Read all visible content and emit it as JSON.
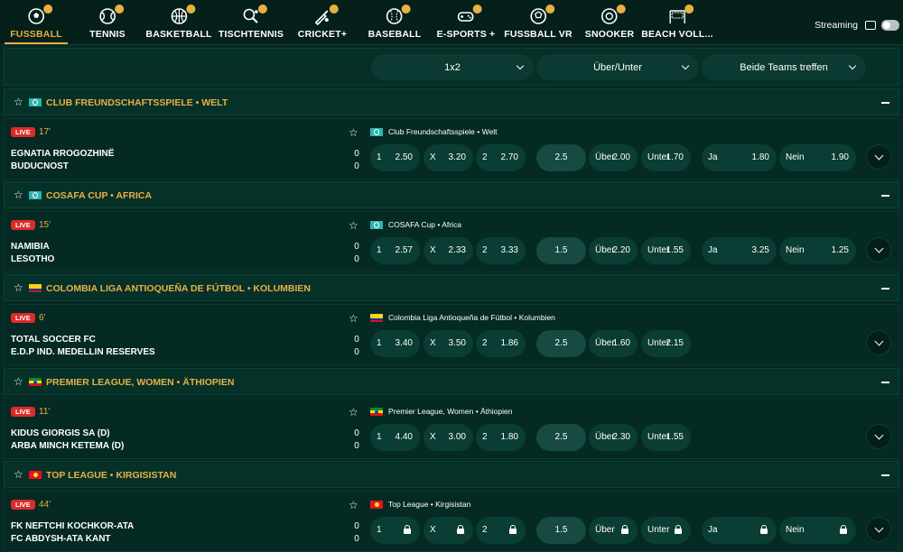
{
  "sports_tabs": [
    {
      "label": "FUSSBALL",
      "icon": "soccer-ball-icon",
      "active": true
    },
    {
      "label": "TENNIS",
      "icon": "tennis-ball-icon"
    },
    {
      "label": "BASKETBALL",
      "icon": "basketball-icon"
    },
    {
      "label": "TISCHTENNIS",
      "icon": "table-tennis-icon"
    },
    {
      "label": "CRICKET+",
      "icon": "cricket-icon"
    },
    {
      "label": "BASEBALL",
      "icon": "baseball-icon"
    },
    {
      "label": "E-SPORTS +",
      "icon": "gamepad-icon"
    },
    {
      "label": "FUSSBALL VR",
      "icon": "soccer-ball-vr-icon"
    },
    {
      "label": "SNOOKER",
      "icon": "snooker-icon"
    },
    {
      "label": "BEACH VOLL...",
      "icon": "beach-volleyball-icon"
    }
  ],
  "streaming": {
    "label": "Streaming",
    "enabled": false
  },
  "filters": {
    "market": "1x2",
    "overunder": "Über/Unter",
    "btts": "Beide Teams treffen"
  },
  "colors": {
    "accent": "#e8b043",
    "live": "#dc2b2b",
    "background": "#052a23"
  },
  "leagues": [
    {
      "title": "CLUB FREUNDSCHAFTSSPIELE • WELT",
      "flag": "world",
      "match": {
        "live": "LIVE",
        "minute": "17'",
        "league": "Club Freundschaftsspiele • Welt",
        "team1": "EGNATIA RROGOZHINË",
        "team2": "BUDUCNOST",
        "score1": "0",
        "score2": "0",
        "odds": {
          "k1": "1",
          "o1": "2.50",
          "kx": "X",
          "ox": "3.20",
          "k2": "2",
          "o2": "2.70",
          "line": "2.5",
          "kover": "Über",
          "oover": "2.00",
          "kunder": "Unter",
          "ounder": "1.70",
          "kyes": "Ja",
          "oyes": "1.80",
          "kno": "Nein",
          "ono": "1.90"
        }
      }
    },
    {
      "title": "COSAFA CUP • AFRICA",
      "flag": "world",
      "match": {
        "live": "LIVE",
        "minute": "15'",
        "league": "COSAFA Cup • Africa",
        "team1": "NAMIBIA",
        "team2": "LESOTHO",
        "score1": "0",
        "score2": "0",
        "odds": {
          "k1": "1",
          "o1": "2.57",
          "kx": "X",
          "ox": "2.33",
          "k2": "2",
          "o2": "3.33",
          "line": "1.5",
          "kover": "Über",
          "oover": "2.20",
          "kunder": "Unter",
          "ounder": "1.55",
          "kyes": "Ja",
          "oyes": "3.25",
          "kno": "Nein",
          "ono": "1.25"
        }
      }
    },
    {
      "title": "COLOMBIA LIGA ANTIOQUEÑA DE FÚTBOL • KOLUMBIEN",
      "flag": "colombia",
      "match": {
        "live": "LIVE",
        "minute": "6'",
        "league": "Colombia Liga Antioqueña de Fútbol • Kolumbien",
        "team1": "TOTAL SOCCER FC",
        "team2": "E.D.P IND. MEDELLIN RESERVES",
        "score1": "0",
        "score2": "0",
        "odds": {
          "k1": "1",
          "o1": "3.40",
          "kx": "X",
          "ox": "3.50",
          "k2": "2",
          "o2": "1.86",
          "line": "2.5",
          "kover": "Über",
          "oover": "1.60",
          "kunder": "Unter",
          "ounder": "2.15"
        }
      }
    },
    {
      "title": "PREMIER LEAGUE, WOMEN • ÄTHIOPIEN",
      "flag": "ethiopia",
      "match": {
        "live": "LIVE",
        "minute": "11'",
        "league": "Premier League, Women • Äthiopien",
        "team1": "KIDUS GIORGIS SA (D)",
        "team2": "ARBA MINCH KETEMA (D)",
        "score1": "0",
        "score2": "0",
        "odds": {
          "k1": "1",
          "o1": "4.40",
          "kx": "X",
          "ox": "3.00",
          "k2": "2",
          "o2": "1.80",
          "line": "2.5",
          "kover": "Über",
          "oover": "2.30",
          "kunder": "Unter",
          "ounder": "1.55"
        }
      }
    },
    {
      "title": "TOP LEAGUE • KIRGISISTAN",
      "flag": "kyrgyzstan",
      "match": {
        "live": "LIVE",
        "minute": "44'",
        "league": "Top League • Kirgisistan",
        "team1": "FK NEFTCHI KOCHKOR-ATA",
        "team2": "FC ABDYSH-ATA KANT",
        "score1": "0",
        "score2": "0",
        "odds": {
          "k1": "1",
          "kx": "X",
          "k2": "2",
          "line": "1.5",
          "kover": "Über",
          "kunder": "Unter",
          "kyes": "Ja",
          "kno": "Nein"
        },
        "locked": true
      }
    }
  ]
}
